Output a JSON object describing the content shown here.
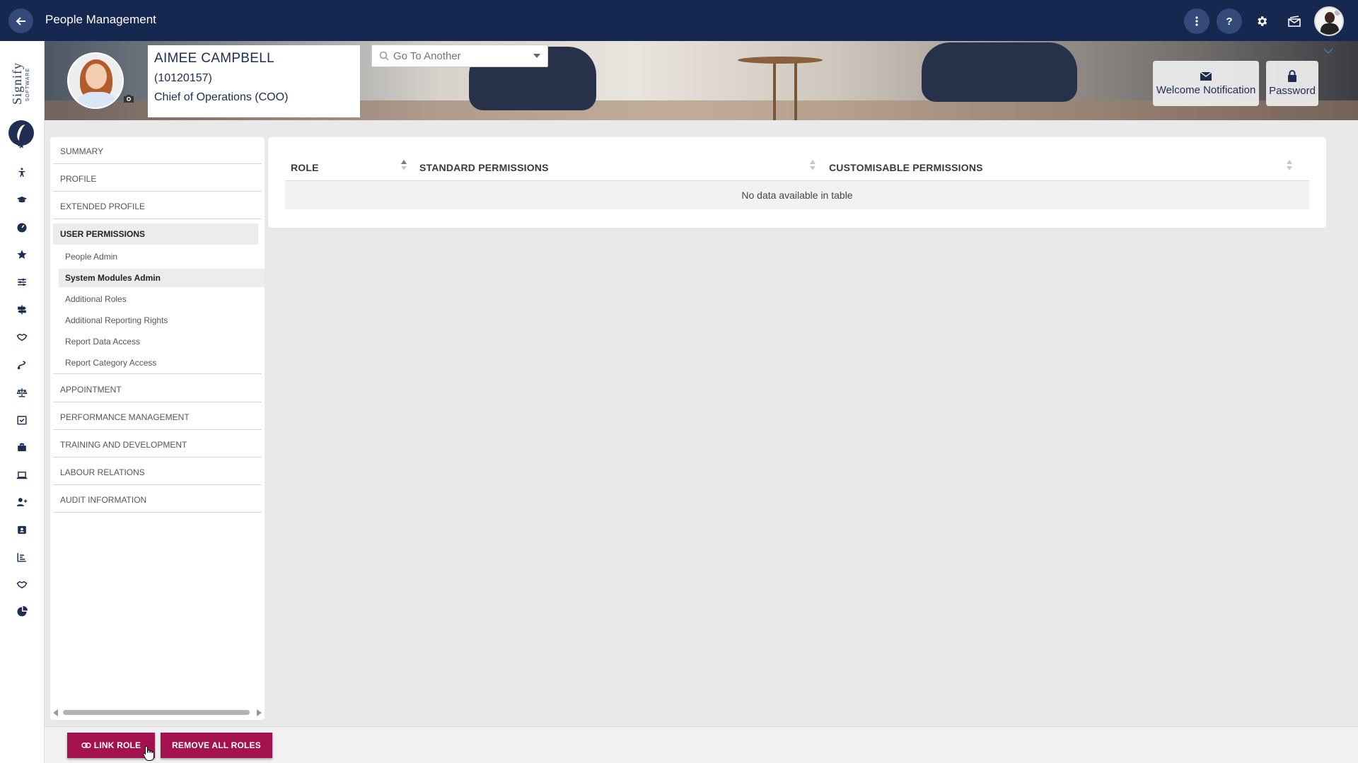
{
  "header": {
    "title": "People Management",
    "back_icon": "arrow-left-icon",
    "icons": [
      "more-vertical-icon",
      "help-icon",
      "gear-icon",
      "mail-icon",
      "user-avatar"
    ]
  },
  "brand": {
    "logo_text": "Signify",
    "logo_sub": "SOFTWARE"
  },
  "profile": {
    "name": "AIMEE CAMPBELL",
    "employee_id": "(10120157)",
    "job_title": "Chief of Operations (COO)"
  },
  "goto": {
    "placeholder": "Go To Another"
  },
  "toolbar": {
    "welcome_label": "Welcome Notification",
    "password_label": "Password"
  },
  "side_menu": {
    "sections_top": [
      "SUMMARY",
      "PROFILE",
      "EXTENDED PROFILE"
    ],
    "active_section": "USER PERMISSIONS",
    "sub_items": [
      "People Admin",
      "System Modules Admin",
      "Additional Roles",
      "Additional Reporting Rights",
      "Report Data Access",
      "Report Category Access"
    ],
    "active_sub": "System Modules Admin",
    "sections_bottom": [
      "APPOINTMENT",
      "PERFORMANCE MANAGEMENT",
      "TRAINING AND DEVELOPMENT",
      "LABOUR RELATIONS",
      "AUDIT INFORMATION"
    ]
  },
  "table": {
    "columns": [
      "ROLE",
      "STANDARD PERMISSIONS",
      "CUSTOMISABLE PERMISSIONS"
    ],
    "empty_message": "No data available in table"
  },
  "actions": {
    "link_role": "LINK ROLE",
    "remove_all": "REMOVE ALL ROLES"
  },
  "rail_icons": [
    "megaphone-icon",
    "accessibility-icon",
    "graduation-cap-icon",
    "gauge-icon",
    "star-icon",
    "sliders-icon",
    "signpost-icon",
    "handshake-icon",
    "route-icon",
    "scales-icon",
    "calendar-check-icon",
    "briefcase-icon",
    "laptop-icon",
    "user-plus-icon",
    "id-badge-icon",
    "bar-chart-icon",
    "handshake-icon-2",
    "pie-chart-icon"
  ],
  "colors": {
    "topbar": "#16284f",
    "accent": "#a3114f",
    "navy": "#1d2d4f"
  }
}
